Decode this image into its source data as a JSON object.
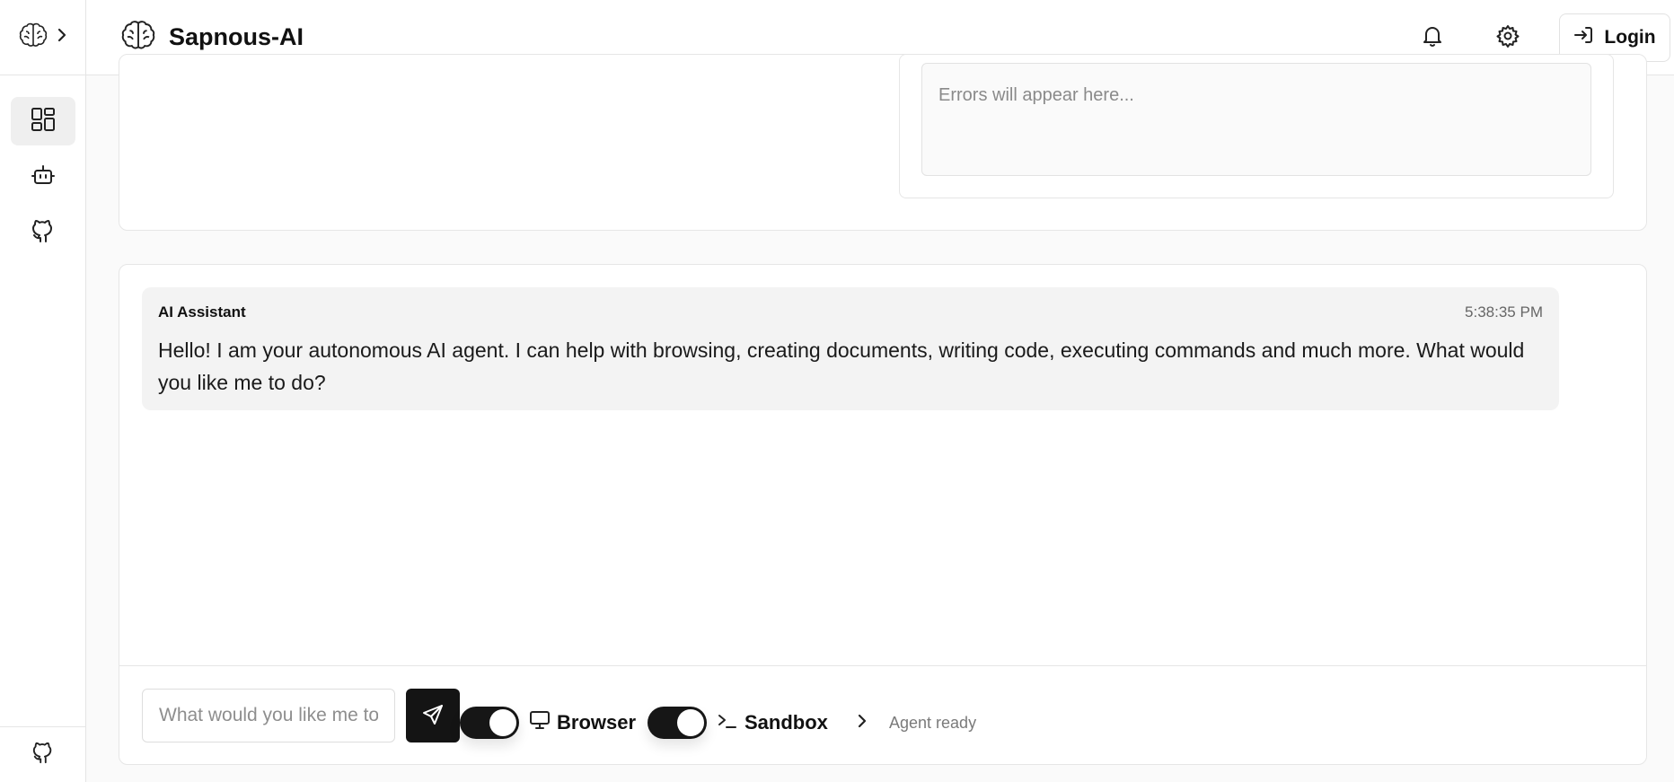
{
  "app": {
    "title": "Sapnous-AI"
  },
  "sidebar": {
    "logo_icon": "brain-icon",
    "expand_icon": "chevron-right-icon",
    "items": [
      {
        "name": "dashboard",
        "icon": "dashboard-icon",
        "active": true
      },
      {
        "name": "agent",
        "icon": "bot-icon",
        "active": false
      },
      {
        "name": "github",
        "icon": "github-icon",
        "active": false
      }
    ],
    "bottom_icon": "github-icon"
  },
  "header": {
    "notification_icon": "bell-icon",
    "settings_icon": "gear-icon",
    "login_label": "Login",
    "login_icon": "login-icon"
  },
  "errors": {
    "placeholder": "Errors will appear here..."
  },
  "chat": {
    "messages": [
      {
        "sender": "AI Assistant",
        "time": "5:38:35 PM",
        "text": "Hello! I am your autonomous AI agent. I can help with browsing, creating documents, writing code, executing commands and much more. What would you like me to do?"
      }
    ],
    "input_placeholder": "What would you like me to do?",
    "send_icon": "send-icon",
    "toggles": [
      {
        "label": "Browser",
        "icon": "monitor-icon",
        "on": true
      },
      {
        "label": "Sandbox",
        "icon": "terminal-icon",
        "on": true
      }
    ],
    "status_text": "Agent ready",
    "status_icon": "chevron-right-icon"
  },
  "colors": {
    "accent": "#141414",
    "panel_bg": "#f3f3f3",
    "border": "#e6e6e6"
  }
}
